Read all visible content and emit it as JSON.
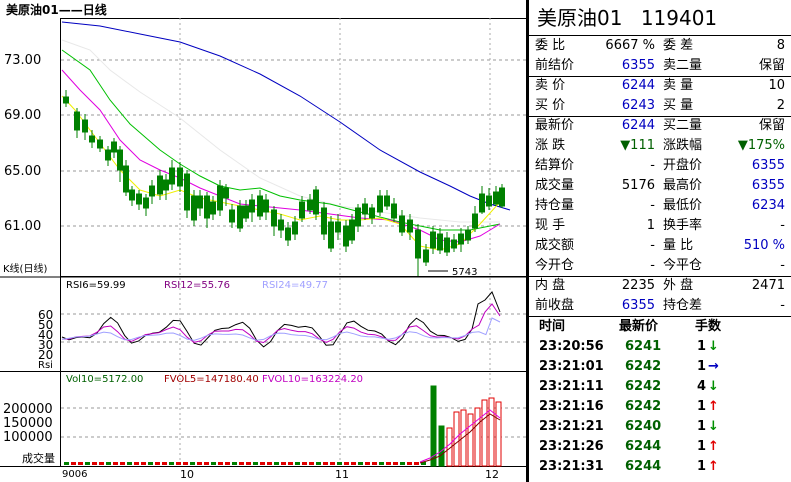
{
  "chart_header": {
    "title": "美原油01——日线"
  },
  "kline": {
    "label": "K线(日线)",
    "y_ticks": [
      "73.00",
      "69.00",
      "65.00",
      "61.00"
    ],
    "low_marker": "5743",
    "colors": {
      "up": "#e00000",
      "down": "#008000",
      "ma_blue": "#0000c0",
      "ma_green": "#00c000",
      "ma_magenta": "#e000e0",
      "ma_yellow": "#f0f000",
      "ma_white": "#e8e8e8"
    }
  },
  "rsi": {
    "rsi6": "RSI6=59.99",
    "rsi12": "RSI12=55.76",
    "rsi24": "RSI24=49.77",
    "label": "Rsi",
    "y_ticks": [
      "60",
      "50",
      "40",
      "30",
      "20"
    ]
  },
  "volume": {
    "vol10": "Vol10=5172.00",
    "fvol5": "FVOL5=147180.40",
    "fvol10": "FVOL10=163224.20",
    "label": "成交量",
    "y_ticks": [
      "200000",
      "150000",
      "100000"
    ]
  },
  "x_axis": {
    "ticks": [
      "9006",
      "10",
      "11",
      "12"
    ]
  },
  "quote": {
    "title": "美原油01",
    "code": "119401",
    "rows": [
      {
        "l": "委  比",
        "v": "6667 %",
        "l2": "委  差",
        "v2": "8"
      },
      {
        "l": "前结价",
        "v": "6355",
        "l2": "卖二量",
        "v2": "保留"
      },
      {
        "l": "卖  价",
        "v": "6244",
        "l2": "卖  量",
        "v2": "10"
      },
      {
        "l": "买  价",
        "v": "6243",
        "l2": "买  量",
        "v2": "2"
      },
      {
        "l": "最新价",
        "v": "6244",
        "l2": "买二量",
        "v2": "保留"
      },
      {
        "l": "涨  跌",
        "v": "▼111",
        "l2": "涨跌幅",
        "v2": "▼175%"
      },
      {
        "l": "结算价",
        "v": "-",
        "l2": "开盘价",
        "v2": "6355"
      },
      {
        "l": "成交量",
        "v": "5176",
        "l2": "最高价",
        "v2": "6355"
      },
      {
        "l": "持仓量",
        "v": "-",
        "l2": "最低价",
        "v2": "6234"
      },
      {
        "l": "现  手",
        "v": "1",
        "l2": "换手率",
        "v2": "-"
      },
      {
        "l": "成交额",
        "v": "-",
        "l2": "量  比",
        "v2": "510 %"
      },
      {
        "l": "今开仓",
        "v": "-",
        "l2": "今平仓",
        "v2": "-"
      },
      {
        "l": "内  盘",
        "v": "2235",
        "l2": "外  盘",
        "v2": "2471"
      },
      {
        "l": "前收盘",
        "v": "6355",
        "l2": "持仓差",
        "v2": "-"
      }
    ]
  },
  "trades": {
    "headers": [
      "时间",
      "最新价",
      "手数"
    ],
    "rows": [
      {
        "time": "23:20:56",
        "price": "6241",
        "qty": "1",
        "dir": "down"
      },
      {
        "time": "23:21:01",
        "price": "6242",
        "qty": "1",
        "dir": "flat"
      },
      {
        "time": "23:21:11",
        "price": "6242",
        "qty": "4",
        "dir": "down"
      },
      {
        "time": "23:21:16",
        "price": "6242",
        "qty": "1",
        "dir": "up"
      },
      {
        "time": "23:21:21",
        "price": "6240",
        "qty": "1",
        "dir": "down"
      },
      {
        "time": "23:21:26",
        "price": "6244",
        "qty": "1",
        "dir": "up"
      },
      {
        "time": "23:21:31",
        "price": "6244",
        "qty": "1",
        "dir": "up"
      }
    ]
  }
}
